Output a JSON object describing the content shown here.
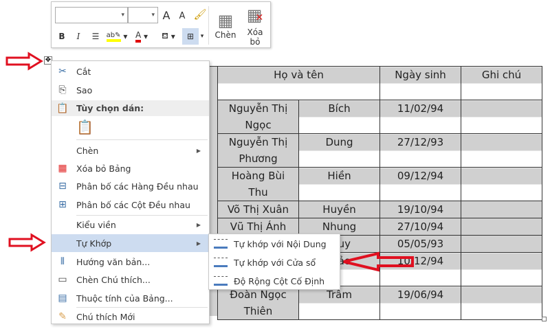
{
  "toolbar": {
    "font_name": "",
    "font_size": "",
    "grow_font": "A",
    "shrink_font": "A",
    "bold": "B",
    "italic": "I",
    "insert_label": "Chèn",
    "delete_label": "Xóa bỏ",
    "colors": {
      "highlight": "#ffff00",
      "font_color": "#e00000"
    }
  },
  "table": {
    "header": [
      "Họ và tên",
      "Ngày sinh",
      "Ghi chú"
    ],
    "rows": [
      {
        "last": [
          "Nguyễn Thị",
          "Ngọc"
        ],
        "first": "Bích",
        "dob": "11/02/94",
        "note": ""
      },
      {
        "last": [
          "Nguyễn Thị",
          "Phương"
        ],
        "first": "Dung",
        "dob": "27/12/93",
        "note": ""
      },
      {
        "last": [
          "Hoàng Bùi",
          "Thu"
        ],
        "first": "Hiền",
        "dob": "09/12/94",
        "note": ""
      },
      {
        "last": [
          "Võ Thị Xuân"
        ],
        "first": "Huyền",
        "dob": "19/10/94",
        "note": ""
      },
      {
        "last": [
          "Vũ Thị Ánh"
        ],
        "first": "Nhung",
        "dob": "27/10/94",
        "note": ""
      },
      {
        "last": [
          ""
        ],
        "first": "uy",
        "dob": "05/05/93",
        "note": ""
      },
      {
        "last": [
          "",
          ""
        ],
        "first": "ảo",
        "dob": "10/12/94",
        "note": ""
      },
      {
        "last": [
          "Đoàn Ngọc",
          "Thiên"
        ],
        "first": "Trâm",
        "dob": "19/06/94",
        "note": ""
      }
    ]
  },
  "context_menu": {
    "items": [
      "Cắt",
      "Sao",
      "Tùy chọn dán:",
      "Chèn",
      "Xóa bỏ Bảng",
      "Phân bố các Hàng Đều nhau",
      "Phân bố các Cột Đều nhau",
      "Kiểu viền",
      "Tự Khớp",
      "Hướng văn bản...",
      "Chèn Chú thích...",
      "Thuộc tính của Bảng...",
      "Chú thích Mới"
    ]
  },
  "submenu": {
    "items": [
      "Tự khớp với Nội Dung",
      "Tự khớp với Cửa sổ",
      "Độ Rộng Cột Cố Định"
    ]
  },
  "annotation_color": "#e01020"
}
